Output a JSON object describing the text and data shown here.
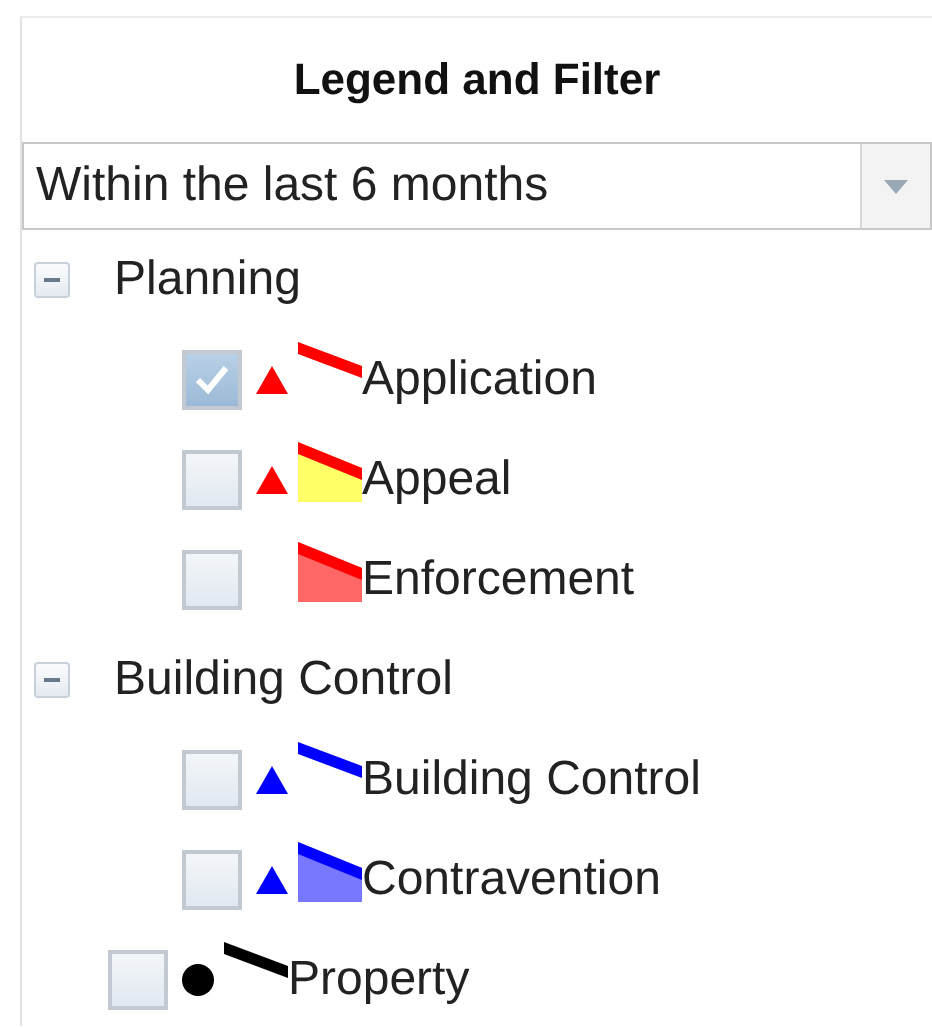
{
  "title": "Legend and Filter",
  "period": {
    "value": "Within the last 6 months"
  },
  "layers": [
    {
      "kind": "group",
      "label": "Planning",
      "expanded": true,
      "children": [
        {
          "label": "Application",
          "checked": true,
          "marker": {
            "kind": "triangle",
            "color": "#ff0000"
          },
          "symbol": {
            "kind": "line",
            "color": "#ff0000"
          }
        },
        {
          "label": "Appeal",
          "checked": false,
          "marker": {
            "kind": "triangle",
            "color": "#ff0000"
          },
          "symbol": {
            "kind": "wedge",
            "color": "#ff0000",
            "area": {
              "color": "#ffff66"
            }
          }
        },
        {
          "label": "Enforcement",
          "checked": false,
          "symbol": {
            "kind": "wedge",
            "color": "#ff0000",
            "area": {
              "color": "#ff6666"
            }
          }
        }
      ]
    },
    {
      "kind": "group",
      "label": "Building Control",
      "expanded": true,
      "children": [
        {
          "label": "Building Control",
          "checked": false,
          "marker": {
            "kind": "triangle",
            "color": "#0000ff"
          },
          "symbol": {
            "kind": "line",
            "color": "#0000ff"
          }
        },
        {
          "label": "Contravention",
          "checked": false,
          "marker": {
            "kind": "triangle",
            "color": "#0000ff"
          },
          "symbol": {
            "kind": "wedge",
            "color": "#0000ff",
            "area": {
              "color": "#7777ff"
            }
          }
        }
      ]
    },
    {
      "kind": "item",
      "label": "Property",
      "checked": false,
      "marker": {
        "kind": "circle",
        "color": "#000000"
      },
      "symbol": {
        "kind": "line",
        "color": "#000000"
      }
    }
  ]
}
